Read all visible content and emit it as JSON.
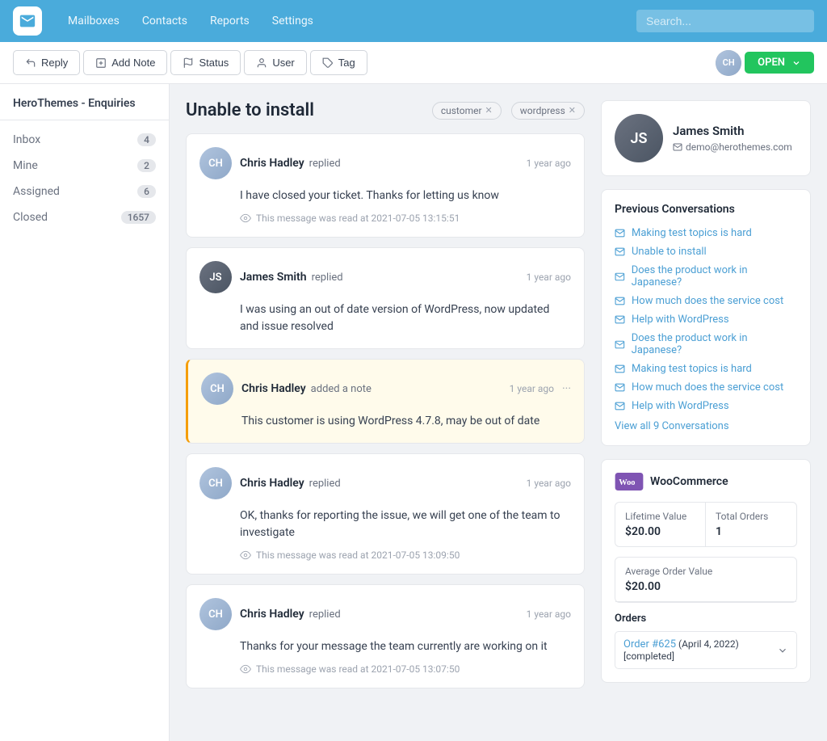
{
  "nav": {
    "links": [
      "Mailboxes",
      "Contacts",
      "Reports",
      "Settings"
    ],
    "search_placeholder": "Search..."
  },
  "toolbar": {
    "reply_label": "Reply",
    "add_note_label": "Add Note",
    "status_label": "Status",
    "user_label": "User",
    "tag_label": "Tag",
    "open_label": "OPEN"
  },
  "sidebar": {
    "title": "HeroThemes - Enquiries",
    "items": [
      {
        "label": "Inbox",
        "count": "4"
      },
      {
        "label": "Mine",
        "count": "2"
      },
      {
        "label": "Assigned",
        "count": "6"
      },
      {
        "label": "Closed",
        "count": "1657"
      }
    ]
  },
  "conversation": {
    "title": "Unable to install",
    "tags": [
      "customer",
      "wordpress"
    ],
    "messages": [
      {
        "id": 1,
        "author": "Chris Hadley",
        "action": "replied",
        "time": "1 year ago",
        "body": "I have closed your ticket. Thanks for letting us know",
        "read_at": "This message was read at 2021-07-05 13:15:51",
        "is_note": false,
        "avatar_initials": "CH"
      },
      {
        "id": 2,
        "author": "James Smith",
        "action": "replied",
        "time": "1 year ago",
        "body": "I was using an out of date version of WordPress, now updated and issue resolved",
        "read_at": null,
        "is_note": false,
        "avatar_initials": "JS"
      },
      {
        "id": 3,
        "author": "Chris Hadley",
        "action": "added a note",
        "time": "1 year ago",
        "body": "This customer is using WordPress 4.7.8, may be out of date",
        "read_at": null,
        "is_note": true,
        "avatar_initials": "CH"
      },
      {
        "id": 4,
        "author": "Chris Hadley",
        "action": "replied",
        "time": "1 year ago",
        "body": "OK, thanks for reporting the issue, we will get one of the team to investigate",
        "read_at": "This message was read at 2021-07-05 13:09:50",
        "is_note": false,
        "avatar_initials": "CH"
      },
      {
        "id": 5,
        "author": "Chris Hadley",
        "action": "replied",
        "time": "1 year ago",
        "body": "Thanks for your message the team currently are working on it",
        "read_at": "This message was read at 2021-07-05 13:07:50",
        "is_note": false,
        "avatar_initials": "CH"
      }
    ]
  },
  "contact": {
    "name": "James Smith",
    "email": "demo@herothemes.com",
    "avatar_initials": "JS"
  },
  "previous_conversations": {
    "title": "Previous Conversations",
    "items": [
      "Making test topics is hard",
      "Unable to install",
      "Does the product work in Japanese?",
      "How much does the service cost",
      "Help with WordPress",
      "Does the product work in Japanese?",
      "Making test topics is hard",
      "How much does the service cost",
      "Help with WordPress"
    ],
    "view_all_label": "View all 9 Conversations"
  },
  "woocommerce": {
    "title": "WooCommerce",
    "lifetime_value_label": "Lifetime Value",
    "lifetime_value": "$20.00",
    "total_orders_label": "Total Orders",
    "total_orders": "1",
    "avg_order_label": "Average Order Value",
    "avg_order_value": "$20.00",
    "orders_label": "Orders",
    "order_link": "Order #625",
    "order_date": "(April 4, 2022)",
    "order_status": "[completed]"
  }
}
